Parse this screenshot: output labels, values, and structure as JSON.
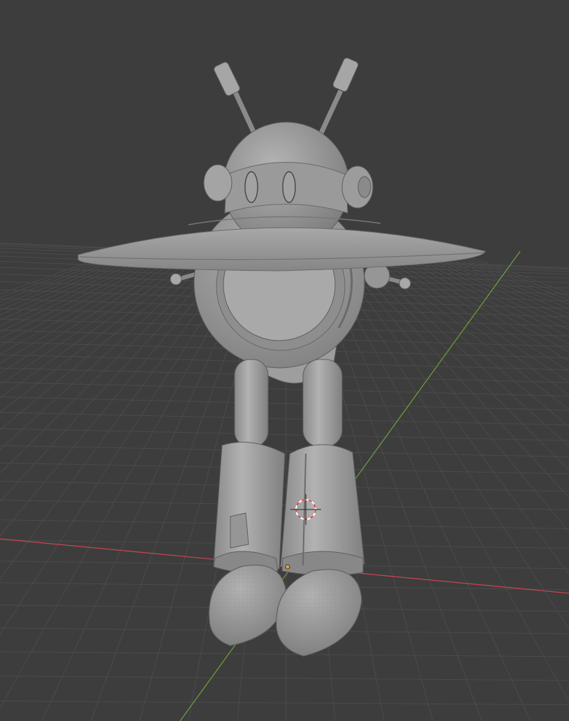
{
  "viewport": {
    "background": "#3d3d3d",
    "grid_color": "#4a4a4a",
    "x_axis_color": "#c8474f",
    "y_axis_color": "#6fa23a",
    "model_color": "#9c9c9c"
  },
  "scene": {
    "object": "robot-model",
    "cursor": "3d-cursor-icon",
    "origin": "origin-point-icon",
    "origin_color": "#e8a23a",
    "cursor_colors": [
      "#e04a4a",
      "#ffffff"
    ]
  }
}
